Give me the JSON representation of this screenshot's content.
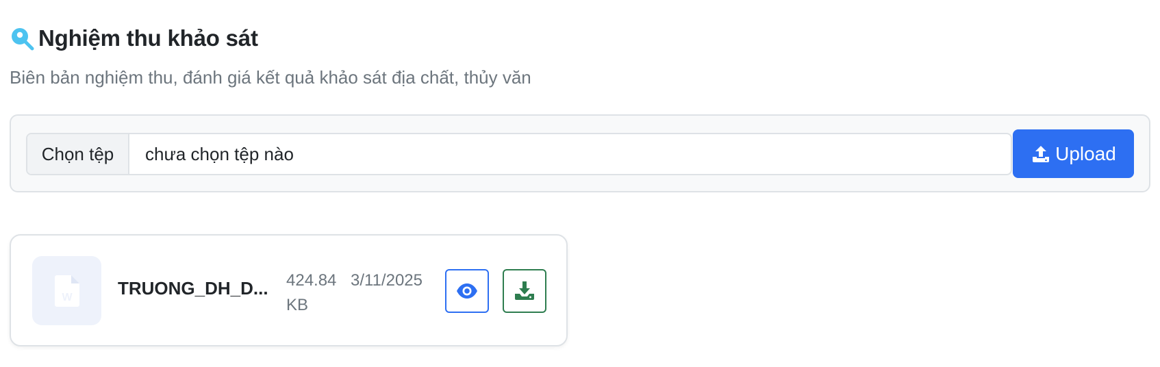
{
  "section": {
    "title": "Nghiệm thu khảo sát",
    "subtitle": "Biên bản nghiệm thu, đánh giá kết quả khảo sát địa chất, thủy văn",
    "icon": "search-location-icon",
    "icon_color": "#4dc3f0"
  },
  "uploader": {
    "choose_label": "Chọn tệp",
    "file_status": "chưa chọn tệp nào",
    "upload_label": "Upload",
    "upload_icon": "upload-icon",
    "upload_color": "#2d6ff2"
  },
  "files": [
    {
      "name": "TRUONG_DH_D...",
      "size_value": "424.84",
      "size_unit": "KB",
      "date": "3/11/2025",
      "type_icon": "word-document-icon",
      "actions": {
        "view_icon": "eye-icon",
        "view_color": "#2d6ff2",
        "download_icon": "download-icon",
        "download_color": "#2e7d4f"
      }
    }
  ]
}
